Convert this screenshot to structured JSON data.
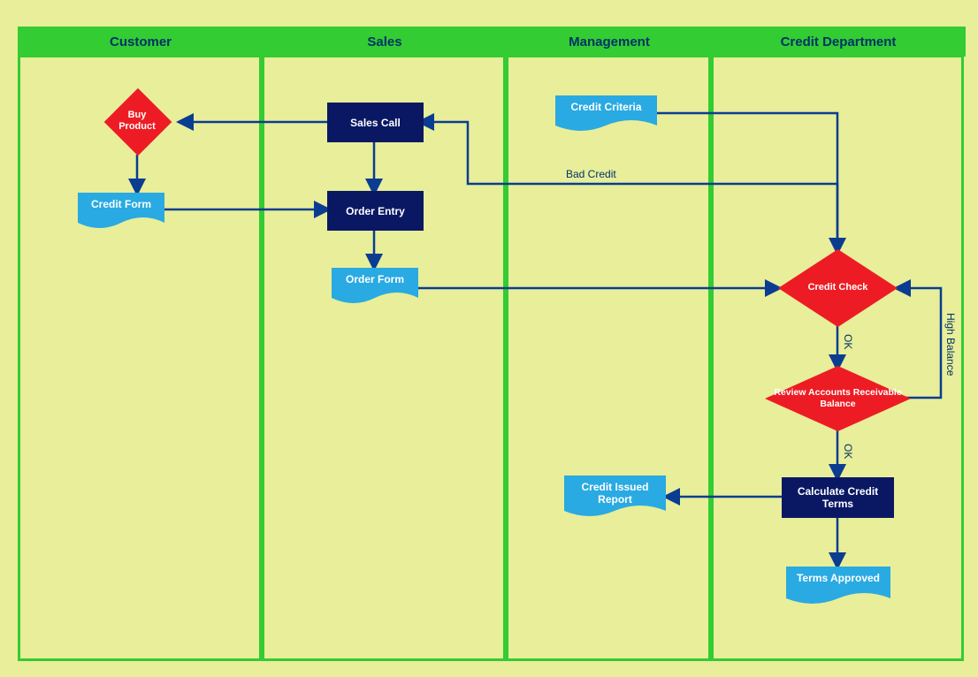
{
  "lanes": {
    "customer": "Customer",
    "sales": "Sales",
    "management": "Management",
    "credit": "Credit Department"
  },
  "nodes": {
    "buy_product": "Buy Product",
    "credit_form": "Credit Form",
    "sales_call": "Sales Call",
    "order_entry": "Order Entry",
    "order_form": "Order Form",
    "credit_criteria": "Credit Criteria",
    "credit_check": "Credit Check",
    "review_balance": "Review Accounts Receivable Balance",
    "calculate_terms": "Calculate Credit Terms",
    "credit_issued_report": "Credit Issued Report",
    "terms_approved": "Terms Approved"
  },
  "edges": {
    "bad_credit": "Bad Credit",
    "ok1": "OK",
    "ok2": "OK",
    "high_balance": "High Balance"
  },
  "colors": {
    "lane_header": "#33cc33",
    "process": "#0a1864",
    "decision": "#ed1c24",
    "document": "#29aae2",
    "arrow": "#0a3d91",
    "bg": "#e8ee99"
  }
}
